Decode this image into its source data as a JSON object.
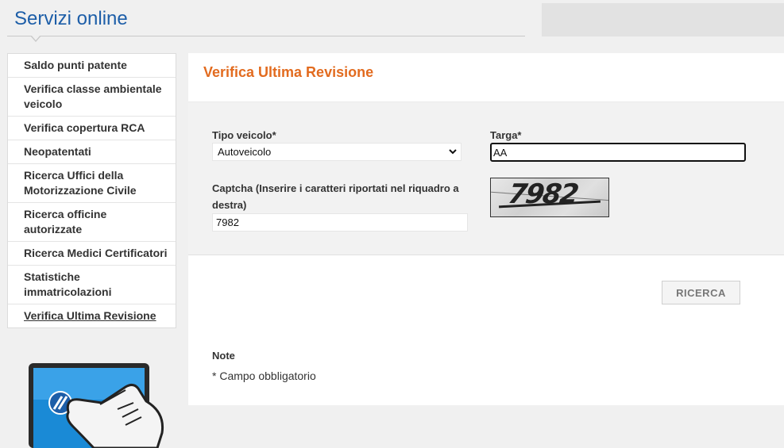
{
  "header": {
    "title": "Servizi online"
  },
  "sidebar": {
    "items": [
      {
        "label": "Saldo punti patente"
      },
      {
        "label": "Verifica classe ambientale veicolo"
      },
      {
        "label": "Verifica copertura RCA"
      },
      {
        "label": "Neopatentati"
      },
      {
        "label": "Ricerca Uffici della Motorizzazione Civile"
      },
      {
        "label": "Ricerca officine autorizzate"
      },
      {
        "label": "Ricerca Medici Certificatori"
      },
      {
        "label": "Statistiche immatricolazioni"
      },
      {
        "label": "Verifica Ultima Revisione"
      }
    ]
  },
  "main": {
    "section_title": "Verifica Ultima Revisione",
    "form": {
      "tipo_veicolo_label": "Tipo veicolo*",
      "tipo_veicolo_value": "Autoveicolo",
      "targa_label": "Targa*",
      "targa_value": "AA",
      "captcha_label": "Captcha (Inserire i caratteri riportati nel riquadro a destra)",
      "captcha_value": "7982",
      "captcha_image_text": "7982"
    },
    "search_button": "RICERCA",
    "note_title": "Note",
    "note_text": "* Campo obbligatorio"
  },
  "colors": {
    "title_blue": "#1d5ea8",
    "section_orange": "#e26b1f"
  },
  "icons": {
    "promo": "laptop-with-pointing-hand-icon",
    "select_arrow": "chevron-down-icon"
  }
}
